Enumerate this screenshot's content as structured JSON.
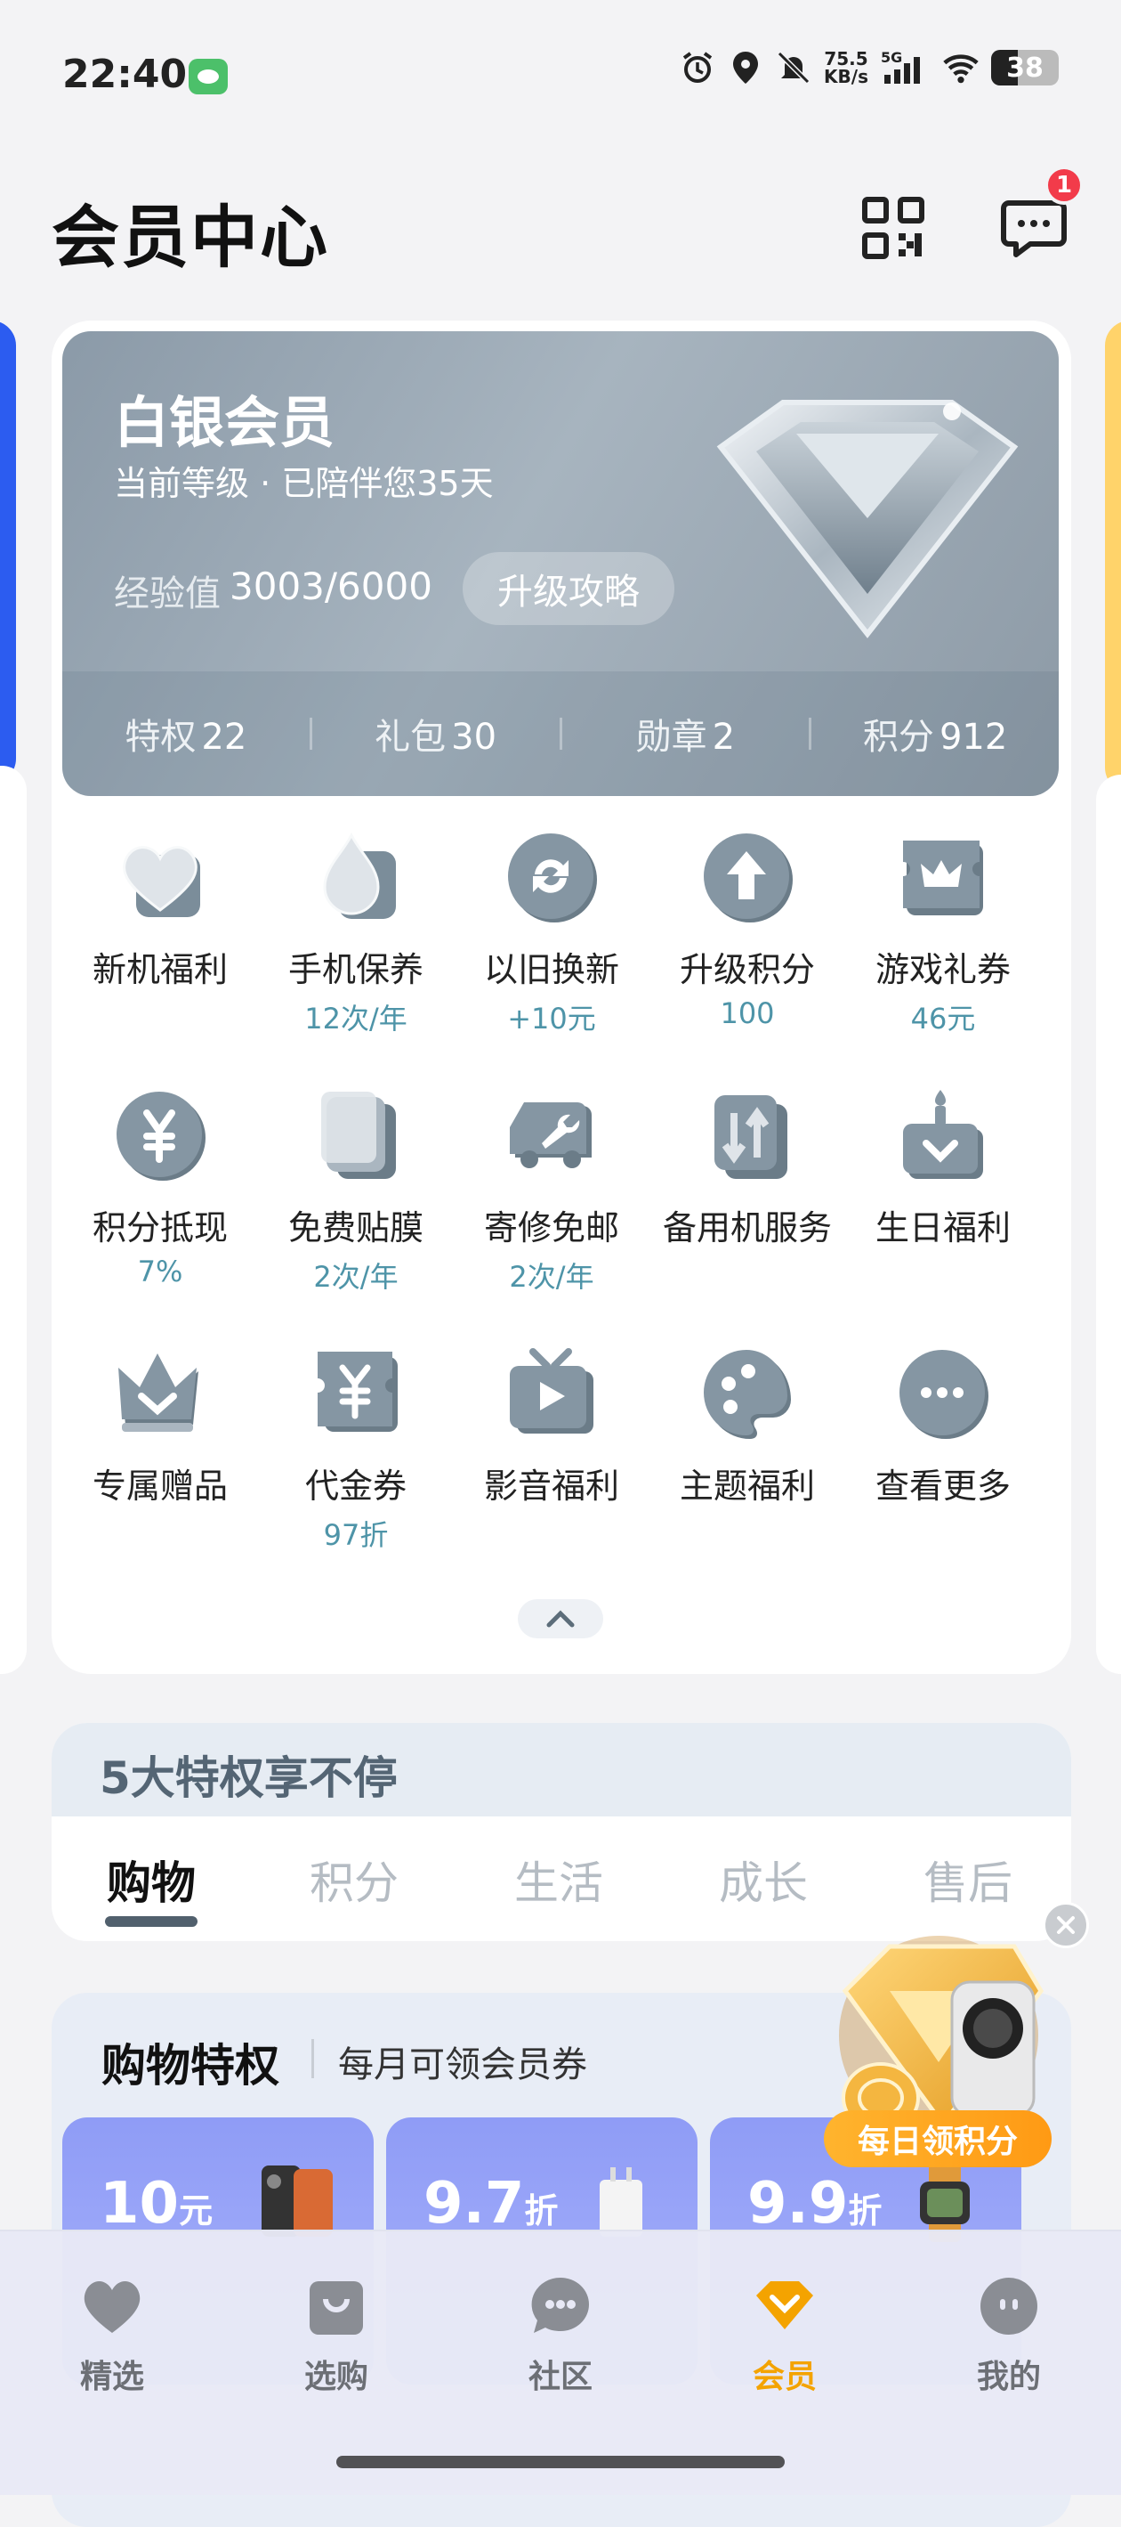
{
  "status_bar": {
    "time": "22:40",
    "speed_value": "75.5",
    "speed_unit": "KB/s",
    "network": "5G",
    "battery": "38"
  },
  "header": {
    "title": "会员中心",
    "message_badge": "1"
  },
  "member_card": {
    "level_name": "白银会员",
    "level_sub": "当前等级 · 已陪伴您35天",
    "exp_label": "经验值",
    "exp_value": "3003/6000",
    "upgrade_button": "升级攻略",
    "stats": [
      {
        "label": "特权",
        "value": "22"
      },
      {
        "label": "礼包",
        "value": "30"
      },
      {
        "label": "勋章",
        "value": "2"
      },
      {
        "label": "积分",
        "value": "912"
      }
    ]
  },
  "benefits": [
    {
      "label": "新机福利",
      "sub": "",
      "icon": "heart-icon"
    },
    {
      "label": "手机保养",
      "sub": "12次/年",
      "icon": "drop-icon"
    },
    {
      "label": "以旧换新",
      "sub": "+10元",
      "icon": "refresh-icon"
    },
    {
      "label": "升级积分",
      "sub": "100",
      "icon": "arrow-up-icon"
    },
    {
      "label": "游戏礼券",
      "sub": "46元",
      "icon": "crown-ticket-icon"
    },
    {
      "label": "积分抵现",
      "sub": "7%",
      "icon": "yen-coin-icon"
    },
    {
      "label": "免费贴膜",
      "sub": "2次/年",
      "icon": "film-icon"
    },
    {
      "label": "寄修免邮",
      "sub": "2次/年",
      "icon": "wrench-truck-icon"
    },
    {
      "label": "备用机服务",
      "sub": "",
      "icon": "swap-phone-icon"
    },
    {
      "label": "生日福利",
      "sub": "",
      "icon": "cake-icon"
    },
    {
      "label": "专属赠品",
      "sub": "",
      "icon": "crown-icon"
    },
    {
      "label": "代金券",
      "sub": "97折",
      "icon": "voucher-icon"
    },
    {
      "label": "影音福利",
      "sub": "",
      "icon": "tv-play-icon"
    },
    {
      "label": "主题福利",
      "sub": "",
      "icon": "palette-icon"
    },
    {
      "label": "查看更多",
      "sub": "",
      "icon": "more-icon"
    }
  ],
  "privileges": {
    "title": "5大特权享不停",
    "tabs": [
      "购物",
      "积分",
      "生活",
      "成长",
      "售后"
    ],
    "active_tab": "购物"
  },
  "shopping": {
    "title": "购物特权",
    "subtitle": "每月可领会员券",
    "coupons": [
      {
        "value": "10",
        "unit": "元"
      },
      {
        "value": "9.7",
        "unit": "折"
      },
      {
        "value": "9.9",
        "unit": "折"
      }
    ]
  },
  "floating": {
    "label": "每日领积分"
  },
  "bottom_nav": [
    {
      "label": "精选",
      "icon": "heart-icon"
    },
    {
      "label": "选购",
      "icon": "bag-icon"
    },
    {
      "label": "社区",
      "icon": "chat-icon"
    },
    {
      "label": "会员",
      "icon": "member-diamond-icon"
    },
    {
      "label": "我的",
      "icon": "face-icon"
    }
  ],
  "colors": {
    "accent": "#f4a300",
    "card_silver": "#94a3b0",
    "sub_text_teal": "#4e94a8",
    "coupon_purple": "#8f9cf6",
    "badge_red": "#f23b4a"
  }
}
